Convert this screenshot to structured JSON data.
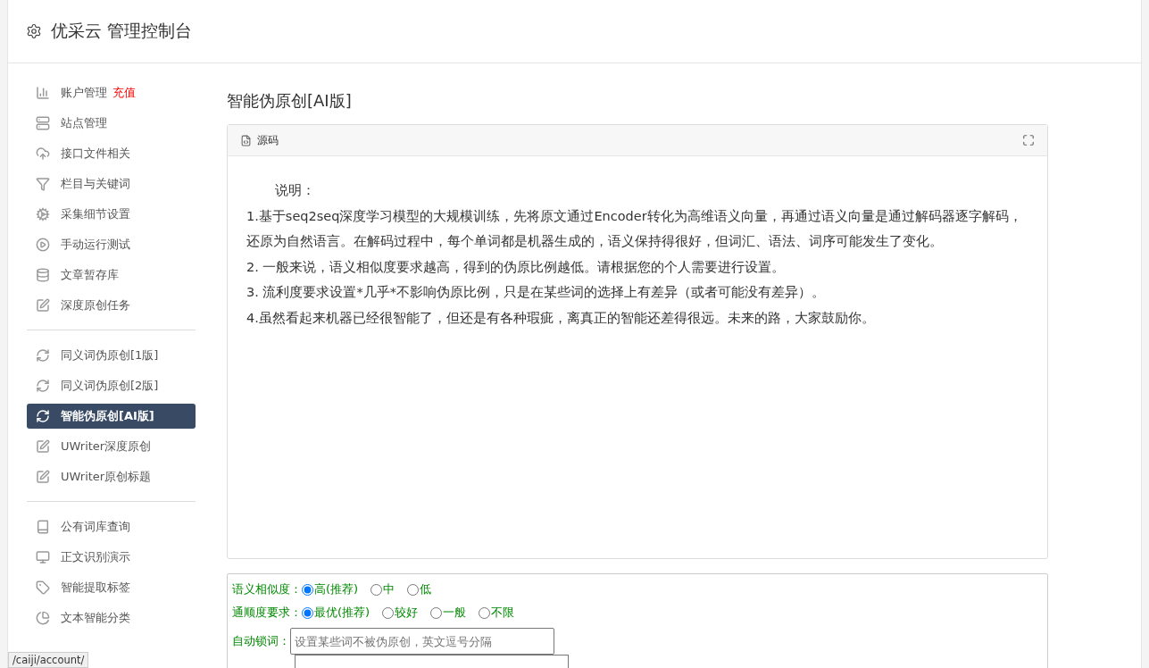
{
  "header": {
    "title": "优采云 管理控制台"
  },
  "sidebar": {
    "groups": [
      {
        "items": [
          {
            "label": "账户管理",
            "badge": "充值",
            "selected": false
          },
          {
            "label": "站点管理",
            "selected": false
          },
          {
            "label": "接口文件相关",
            "selected": false
          },
          {
            "label": "栏目与关键词",
            "selected": false
          },
          {
            "label": "采集细节设置",
            "selected": false
          },
          {
            "label": "手动运行测试",
            "selected": false
          },
          {
            "label": "文章暂存库",
            "selected": false
          },
          {
            "label": "深度原创任务",
            "selected": false
          }
        ]
      },
      {
        "items": [
          {
            "label": "同义词伪原创[1版]",
            "selected": false
          },
          {
            "label": "同义词伪原创[2版]",
            "selected": false
          },
          {
            "label": "智能伪原创[AI版]",
            "selected": true
          },
          {
            "label": "UWriter深度原创",
            "selected": false
          },
          {
            "label": "UWriter原创标题",
            "selected": false
          }
        ]
      },
      {
        "items": [
          {
            "label": "公有词库查询",
            "selected": false
          },
          {
            "label": "正文识别演示",
            "selected": false
          },
          {
            "label": "智能提取标签",
            "selected": false
          },
          {
            "label": "文本智能分类",
            "selected": false
          }
        ]
      }
    ]
  },
  "main": {
    "title": "智能伪原创[AI版]",
    "editor": {
      "tab": "源码",
      "intro": "说明：",
      "paragraphs": [
        "1.基于seq2seq深度学习模型的大规模训练，先将原文通过Encoder转化为高维语义向量，再通过语义向量是通过解码器逐字解码，还原为自然语言。在解码过程中，每个单词都是机器生成的，语义保持得很好，但词汇、语法、词序可能发生了变化。",
        "2. 一般来说，语义相似度要求越高，得到的伪原比例越低。请根据您的个人需要进行设置。",
        "3. 流利度要求设置*几乎*不影响伪原比例，只是在某些词的选择上有差异（或者可能没有差异）。",
        "4.虽然看起来机器已经很智能了，但还是有各种瑕疵，离真正的智能还差得很远。未来的路，大家鼓励你。"
      ]
    },
    "options": [
      {
        "kind": "radio",
        "label": "语义相似度：",
        "choices": [
          {
            "label": "高(推荐)",
            "selected": true
          },
          {
            "label": "中",
            "selected": false
          },
          {
            "label": "低",
            "selected": false
          }
        ]
      },
      {
        "kind": "radio",
        "label": "通顺度要求：",
        "choices": [
          {
            "label": "最优(推荐)",
            "selected": true
          },
          {
            "label": "较好",
            "selected": false
          },
          {
            "label": "一般",
            "selected": false
          },
          {
            "label": "不限",
            "selected": false
          }
        ]
      },
      {
        "kind": "text",
        "label": "自动锁词：",
        "placeholder": "设置某些词不被伪原创，英文逗号分隔"
      }
    ]
  },
  "status_url": "/caiji/account/"
}
